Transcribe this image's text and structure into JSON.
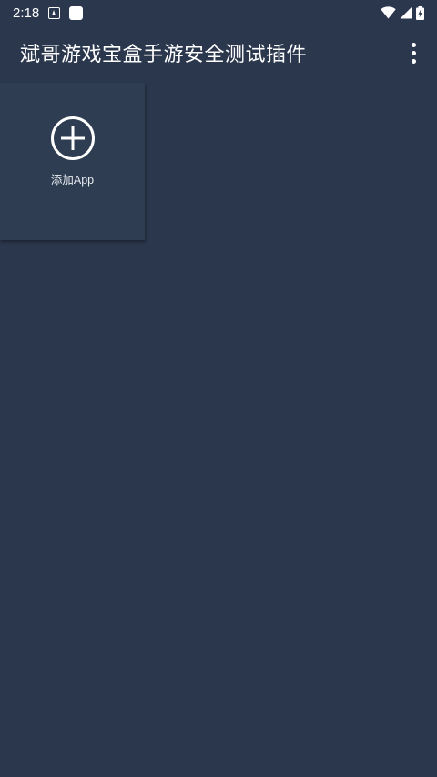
{
  "status_bar": {
    "time": "2:18",
    "icons": [
      "notification-a-icon",
      "notification-square-icon",
      "wifi-icon",
      "signal-icon",
      "battery-charging-icon"
    ]
  },
  "app_bar": {
    "title": "斌哥游戏宝盒手游安全测试插件",
    "menu_icon": "more-vert-icon"
  },
  "tiles": [
    {
      "label": "添加App",
      "icon": "add-circle-icon"
    }
  ],
  "colors": {
    "background": "#2b374d",
    "tile": "#2f3d52",
    "text": "#ffffff"
  }
}
